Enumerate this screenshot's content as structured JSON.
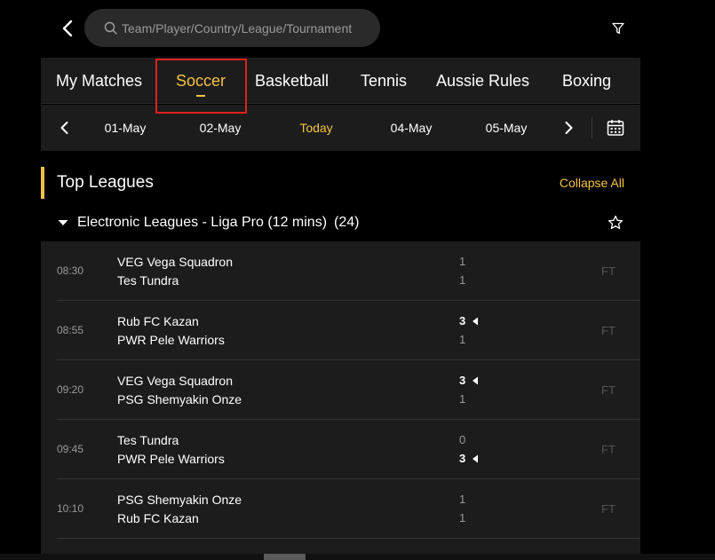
{
  "search": {
    "placeholder": "Team/Player/Country/League/Tournament"
  },
  "icons": {
    "back": "chevron-left-icon",
    "search": "search-icon",
    "filter": "filter-icon",
    "calendar": "calendar-icon",
    "star": "star-icon"
  },
  "sport_tabs": [
    {
      "label": "My Matches",
      "active": false
    },
    {
      "label": "Soccer",
      "active": true
    },
    {
      "label": "Basketball",
      "active": false
    },
    {
      "label": "Tennis",
      "active": false
    },
    {
      "label": "Aussie Rules",
      "active": false
    },
    {
      "label": "Boxing",
      "active": false
    }
  ],
  "dates": [
    {
      "label": "01-May",
      "active": false
    },
    {
      "label": "02-May",
      "active": false
    },
    {
      "label": "Today",
      "active": true
    },
    {
      "label": "04-May",
      "active": false
    },
    {
      "label": "05-May",
      "active": false
    }
  ],
  "top_leagues": {
    "title": "Top Leagues",
    "collapse_label": "Collapse All"
  },
  "league": {
    "name": "Electronic Leagues - Liga Pro (12 mins)",
    "count": "(24)"
  },
  "matches": [
    {
      "time": "08:30",
      "team1": "VEG Vega Squadron",
      "team2": "Tes Tundra",
      "score1": "1",
      "score2": "1",
      "winner": 0,
      "status": "FT"
    },
    {
      "time": "08:55",
      "team1": "Rub FC Kazan",
      "team2": "PWR Pele Warriors",
      "score1": "3",
      "score2": "1",
      "winner": 1,
      "status": "FT"
    },
    {
      "time": "09:20",
      "team1": "VEG Vega Squadron",
      "team2": "PSG Shemyakin Onze",
      "score1": "3",
      "score2": "1",
      "winner": 1,
      "status": "FT"
    },
    {
      "time": "09:45",
      "team1": "Tes Tundra",
      "team2": "PWR Pele Warriors",
      "score1": "0",
      "score2": "3",
      "winner": 2,
      "status": "FT"
    },
    {
      "time": "10:10",
      "team1": "PSG Shemyakin Onze",
      "team2": "Rub FC Kazan",
      "score1": "1",
      "score2": "1",
      "winner": 0,
      "status": "FT"
    }
  ],
  "colors": {
    "accent": "#f5c342",
    "highlight_box": "#e02020",
    "panel_bg": "#1c1c1c",
    "page_bg": "#000000"
  }
}
